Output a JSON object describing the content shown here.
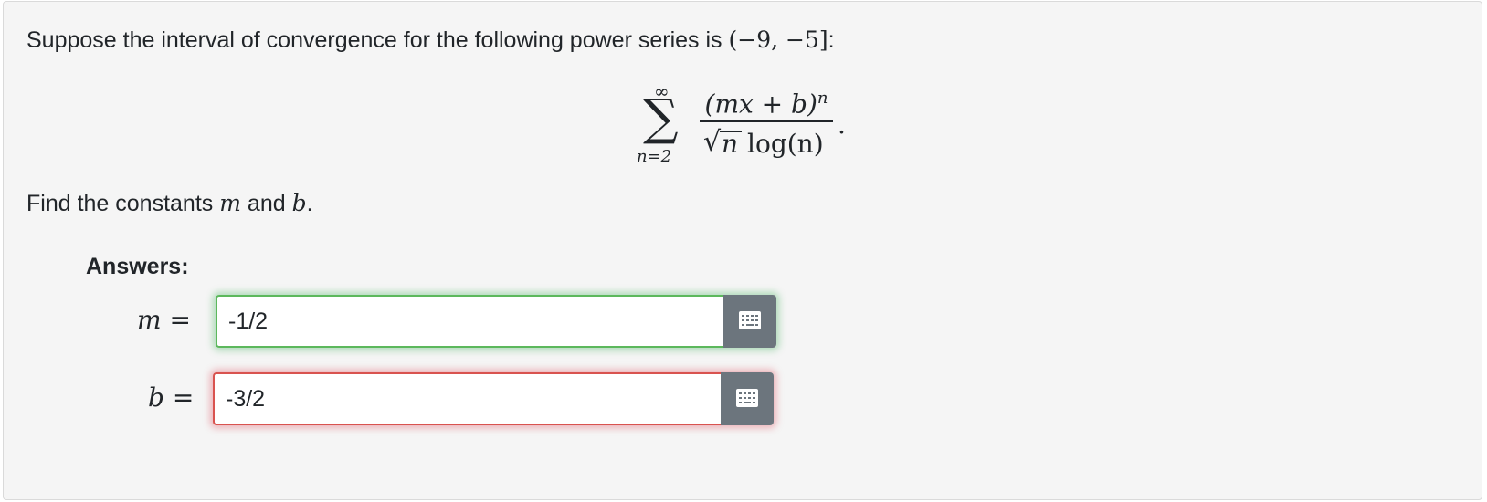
{
  "problem": {
    "intro": "Suppose the interval of convergence for the following power series is",
    "interval": "(−9, −5]",
    "colon": ":",
    "series": {
      "upper_limit": "∞",
      "lower_limit": "n=2",
      "numerator": "(mx + b)",
      "numerator_exponent": "n",
      "sqrt_arg": "n",
      "denominator_rest": "log(n)",
      "end": "."
    },
    "find_prefix": "Find the constants",
    "find_m": "m",
    "find_and": "and",
    "find_b": "b",
    "find_end": "."
  },
  "answers": {
    "heading": "Answers:",
    "m": {
      "var": "m",
      "equals": "=",
      "value": "-1/2",
      "status": "correct",
      "status_color": "#5cb85c"
    },
    "b": {
      "var": "b",
      "equals": "=",
      "value": "-3/2",
      "status": "incorrect",
      "status_color": "#d9534f"
    },
    "keypad_icon": "keypad-grid-icon"
  }
}
